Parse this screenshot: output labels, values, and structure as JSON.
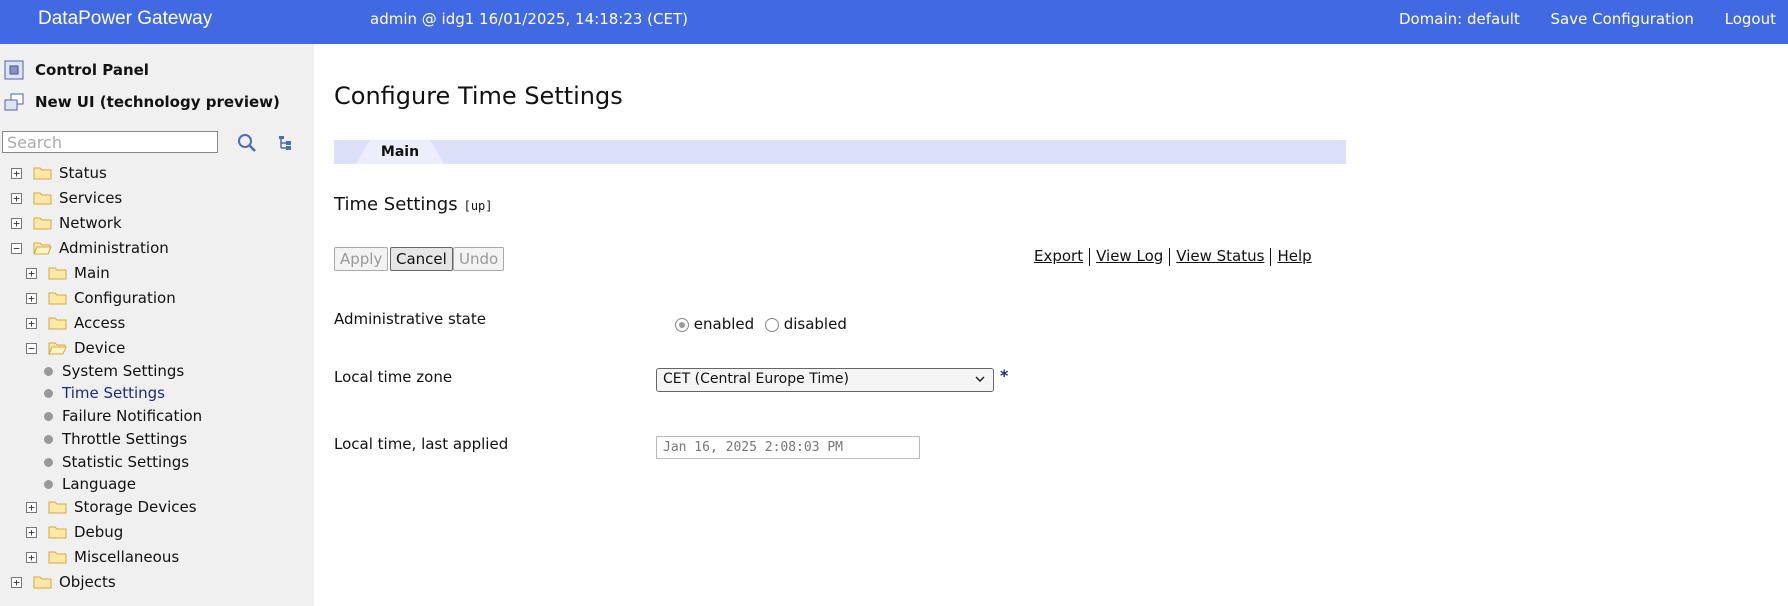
{
  "topbar": {
    "brand": "DataPower Gateway",
    "session": "admin @ idg1 16/01/2025, 14:18:23 (CET)",
    "domain": "Domain: default",
    "save": "Save Configuration",
    "logout": "Logout"
  },
  "sidebar": {
    "control_panel": "Control Panel",
    "new_ui": "New UI (technology preview)",
    "search_placeholder": "Search",
    "tree": {
      "status": "Status",
      "services": "Services",
      "network": "Network",
      "administration": "Administration",
      "main": "Main",
      "configuration": "Configuration",
      "access": "Access",
      "device": "Device",
      "system_settings": "System Settings",
      "time_settings": "Time Settings",
      "failure_notification": "Failure Notification",
      "throttle_settings": "Throttle Settings",
      "statistic_settings": "Statistic Settings",
      "language": "Language",
      "storage_devices": "Storage Devices",
      "debug": "Debug",
      "miscellaneous": "Miscellaneous",
      "objects": "Objects"
    },
    "expand_symbol": "+",
    "collapse_symbol": "−"
  },
  "main": {
    "title": "Configure Time Settings",
    "tab_main": "Main",
    "section_title": "Time Settings",
    "up_link": "[up]",
    "buttons": {
      "apply": "Apply",
      "cancel": "Cancel",
      "undo": "Undo"
    },
    "links": {
      "export": "Export",
      "view_log": "View Log",
      "view_status": "View Status",
      "help": "Help"
    },
    "fields": {
      "admin_state_label": "Administrative state",
      "enabled": "enabled",
      "disabled": "disabled",
      "admin_state_value": "enabled",
      "timezone_label": "Local time zone",
      "timezone_value": "CET (Central Europe Time)",
      "required_marker": "*",
      "last_applied_label": "Local time, last applied",
      "last_applied_value": "Jan 16, 2025 2:08:03 PM"
    }
  },
  "colors": {
    "topbar": "#4169e1",
    "sidebar": "#f0f0f0",
    "tabbar": "#dde1f7",
    "accent_text": "#1a2b80"
  }
}
